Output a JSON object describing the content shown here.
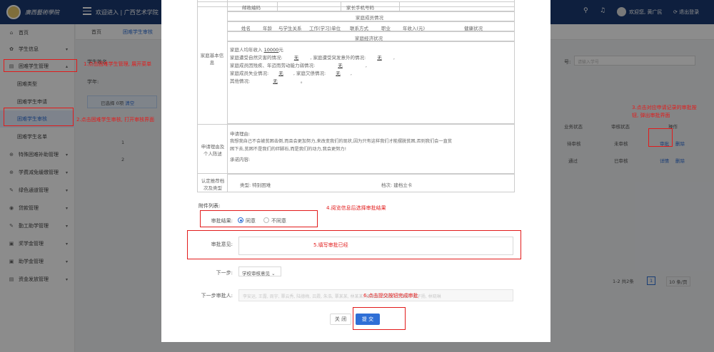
{
  "header": {
    "logo_text": "廣西藝術學院",
    "welcome": "欢迎进入 | 广西艺术学院",
    "user_greet": "欢迎您, 黄广民",
    "logout": "退出登录"
  },
  "sidebar": {
    "items": [
      {
        "label": "首页",
        "icon": "⌂"
      },
      {
        "label": "学生信息",
        "icon": "✿"
      },
      {
        "label": "困难学生管理",
        "icon": "▤"
      },
      {
        "label": "困难类型",
        "icon": ""
      },
      {
        "label": "困难学生申请",
        "icon": ""
      },
      {
        "label": "困难学生审核",
        "icon": ""
      },
      {
        "label": "困难学生名单",
        "icon": ""
      },
      {
        "label": "特殊困难补助管理",
        "icon": "⊕"
      },
      {
        "label": "学费减免缓缴管理",
        "icon": "⊕"
      },
      {
        "label": "绿色通道管理",
        "icon": "✎"
      },
      {
        "label": "贷款管理",
        "icon": "◉"
      },
      {
        "label": "勤工助学管理",
        "icon": "✎"
      },
      {
        "label": "奖学金管理",
        "icon": "▣"
      },
      {
        "label": "助学金管理",
        "icon": "▣"
      },
      {
        "label": "资金发放管理",
        "icon": "▤"
      }
    ]
  },
  "tabs": [
    "首页",
    "困难学生审核"
  ],
  "filters": {
    "student_type_label": "学生姓名",
    "number_label": "号:",
    "number_placeholder": "请输入学号",
    "year_label": "学年:",
    "selected_label": "已选择",
    "selected_count": "0项",
    "clear": "清空"
  },
  "bg_table": {
    "headers": [
      "业务状态",
      "审核状态",
      "操作"
    ],
    "rows": [
      {
        "num": "1",
        "biz": "待审核",
        "audit": "未审核",
        "op1": "审批",
        "op2": "删除"
      },
      {
        "num": "2",
        "biz": "通过",
        "audit": "已审核",
        "op1": "详情",
        "op2": "删除"
      }
    ],
    "pager": "1-2 共2条",
    "page": "1",
    "page_size": "10 条/页"
  },
  "form": {
    "postcode_label": "邮政编码",
    "parent_phone_label": "家长手机号码",
    "family_members_header": "家庭成员情况",
    "member_cols": [
      "姓名",
      "年龄",
      "与学生关系",
      "工作(学习)单位",
      "联系方式",
      "职业",
      "年收入(元)",
      "健康状况"
    ],
    "economic_header": "家庭经济状况",
    "family_basic_label": "家庭基本信息",
    "income_label": "家庭人均年收入",
    "income_value": "10000",
    "income_unit": "元",
    "disaster_label": "家庭遭受自然灾害的情况:",
    "disaster_value": "无",
    "accident_label": "家庭遭受突发意外的情况:",
    "accident_value": "无",
    "disability_label": "家庭成员因残疾、年迈而劳动能力弱情况:",
    "disability_value": "无",
    "unemployment_label": "家庭成员失业情况:",
    "unemployment_value": "无",
    "debt_label": "家庭欠债情况:",
    "debt_value": "无",
    "other_label": "其他情况:",
    "other_value": "无",
    "reason_label": "申请理由及个人陈述",
    "reason_title": "申请理由:",
    "reason_text_1": "我想我自己不会被贫困击倒,而且会更加努力,来改变我们的现状,因为只有这样我们才能摆脱贫困,否则我们会一直贫",
    "reason_text_2": "困下去,贫困不是我们的绊脚石,而是我们的动力,我会更努力!",
    "promise_label": "承诺内容:",
    "recommend_label": "认定推荐档次及类型",
    "type_label": "类型:",
    "type_value": "特别困难",
    "level_label": "档次:",
    "level_value": "建档立卡",
    "attachments": "附件列表:",
    "approval_result_label": "审批结果:",
    "agree": "同意",
    "disagree": "不同意",
    "opinion_label": "审批意见:",
    "next_step_label": "下一步:",
    "next_step_value": "学校审核意见",
    "next_approver_label": "下一步审批人:",
    "next_approvers": "李安运, 王露, 周宇, 覃云秀, 陆德梅, 吕霞, 朱浩, 覃某某, 林某某, 黄某某, 韦某某, 刘某某, 黄子扬, 林晓琳",
    "close_btn": "关 闭",
    "submit_btn": "提 交"
  },
  "annotations": {
    "a1": "1.点击困难学生管理, 展开菜单",
    "a2": "2.点击困难学生审核, 打开审核界面",
    "a3_1": "3.点击对应申请记录的审批按",
    "a3_2": "钮, 弹出审批界面",
    "a4": "4.阅览信息后选择审批结果",
    "a5": "5.填写审批已经",
    "a6": "6.点击提交按钮完成审批"
  },
  "colors": {
    "header_bg": "#1b3a72",
    "accent": "#2f6fd6",
    "annotation": "#e21b1b"
  }
}
